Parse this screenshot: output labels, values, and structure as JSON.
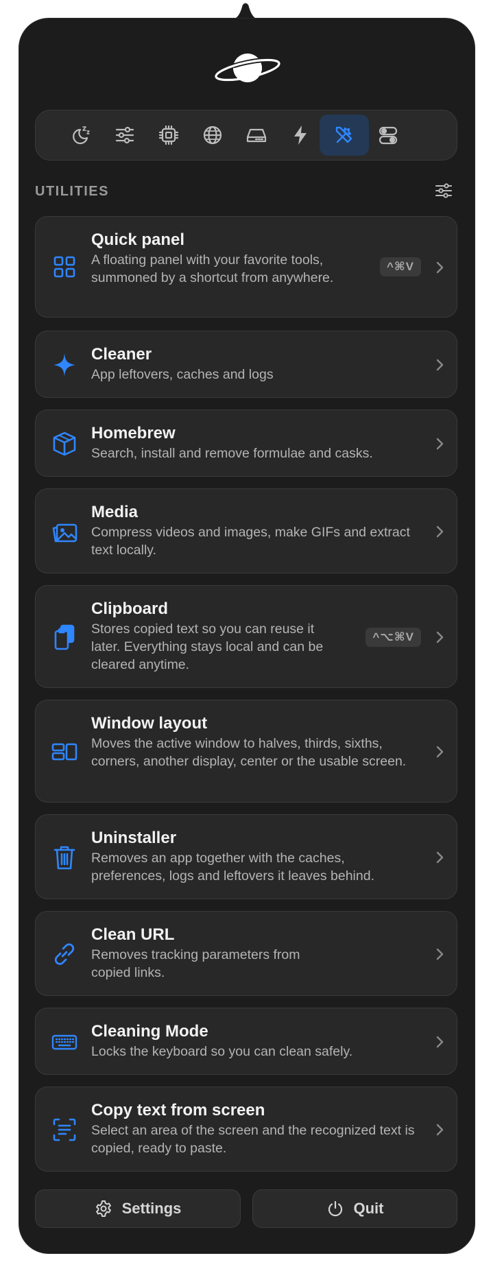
{
  "header": {
    "logo_icon": "saturn-icon",
    "tabs": [
      {
        "icon": "sleep-moon-icon",
        "active": false
      },
      {
        "icon": "sliders-icon",
        "active": false
      },
      {
        "icon": "cpu-chip-icon",
        "active": false
      },
      {
        "icon": "globe-icon",
        "active": false
      },
      {
        "icon": "disk-drive-icon",
        "active": false
      },
      {
        "icon": "bolt-icon",
        "active": false
      },
      {
        "icon": "tools-icon",
        "active": true
      },
      {
        "icon": "toggles-icon",
        "active": false
      }
    ]
  },
  "section": {
    "title": "UTILITIES",
    "filter_icon": "filter-sliders-icon"
  },
  "utilities": [
    {
      "title": "Quick panel",
      "description": "A floating panel with your favorite tools, summoned by a shortcut from anywhere.",
      "shortcut": "^⌘V",
      "icon": "grid-icon"
    },
    {
      "title": "Cleaner",
      "description": "App leftovers, caches and logs",
      "icon": "sparkle-icon"
    },
    {
      "title": "Homebrew",
      "description": "Search, install and remove formulae and casks.",
      "icon": "box-icon"
    },
    {
      "title": "Media",
      "description": "Compress videos and images, make GIFs and extract text locally.",
      "icon": "photos-icon"
    },
    {
      "title": "Clipboard",
      "description": "Stores copied text so you can reuse it later. Everything stays local and can be cleared anytime.",
      "shortcut": "^⌥⌘V",
      "icon": "clipboard-icon"
    },
    {
      "title": "Window layout",
      "description": "Moves the active window to halves, thirds, sixths, corners, another display, center or the usable screen.",
      "icon": "window-layout-icon"
    },
    {
      "title": "Uninstaller",
      "description": "Removes an app together with the caches, preferences, logs and leftovers it leaves behind.",
      "icon": "trash-icon"
    },
    {
      "title": "Clean URL",
      "description": "Removes tracking parameters from copied links.",
      "icon": "link-icon"
    },
    {
      "title": "Cleaning Mode",
      "description": "Locks the keyboard so you can clean safely.",
      "icon": "keyboard-icon"
    },
    {
      "title": "Copy text from screen",
      "description": "Select an area of the screen and the recognized text is copied, ready to paste.",
      "icon": "text-scan-icon"
    }
  ],
  "footer": {
    "settings_label": "Settings",
    "quit_label": "Quit"
  },
  "colors": {
    "accent": "#2f86ff",
    "background": "#1c1c1c",
    "card": "#282828"
  }
}
